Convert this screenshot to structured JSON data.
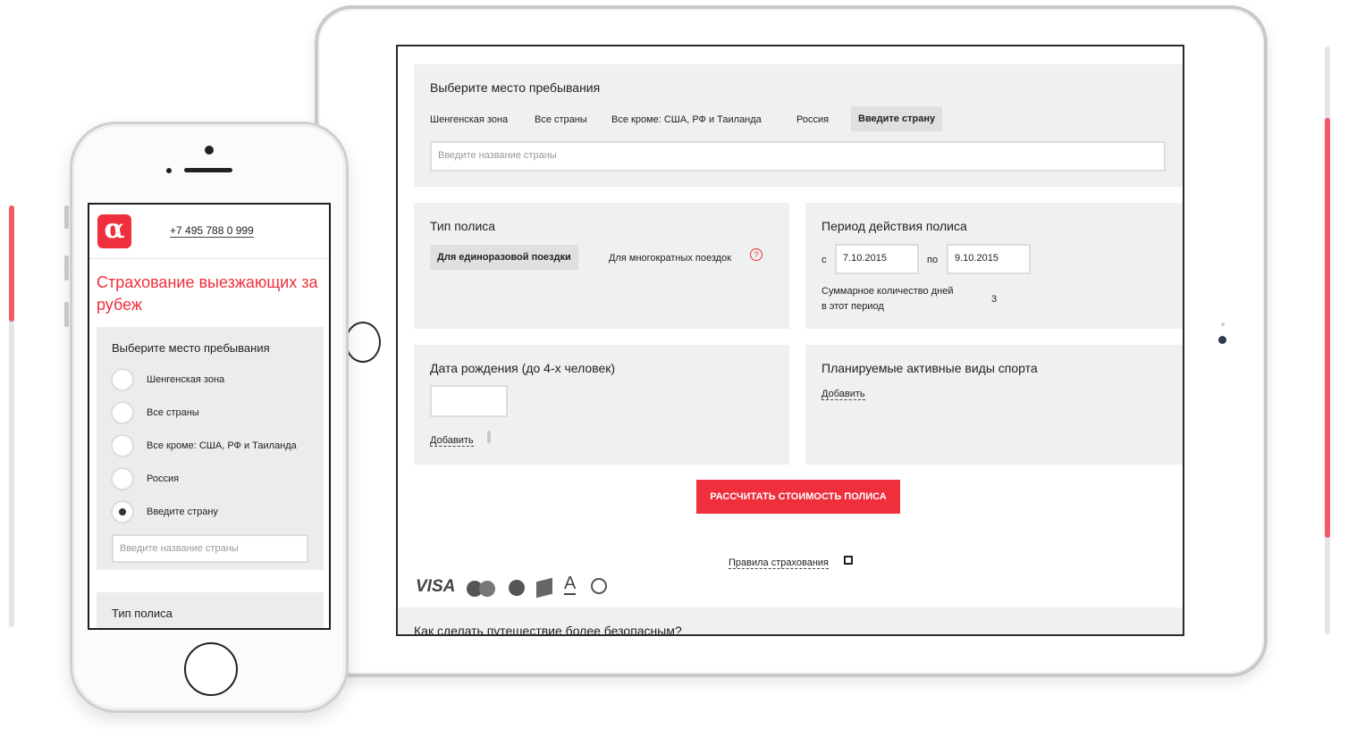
{
  "tablet": {
    "place_section": {
      "title": "Выберите место пребывания",
      "tabs": [
        "Шенгенская зона",
        "Все страны",
        "Все кроме: США, РФ и Таиланда",
        "Россия",
        "Введите страну"
      ],
      "active_tab": "Введите страну",
      "country_placeholder": "Введите название страны"
    },
    "policy_type": {
      "title": "Тип полиса",
      "option_single": "Для единоразовой поездки",
      "option_multi": "Для многократных поездок",
      "help_icon": "?"
    },
    "period": {
      "title": "Период действия полиса",
      "from_label": "с",
      "from_value": "7.10.2015",
      "to_label": "по",
      "to_value": "9.10.2015",
      "days_label_line1": "Суммарное количество дней",
      "days_label_line2": "в этот период",
      "days_value": "3"
    },
    "birth": {
      "title": "Дата рождения (до 4-х человек)",
      "add_link": "Добавить"
    },
    "sports": {
      "title": "Планируемые активные виды спорта",
      "add_link": "Добавить"
    },
    "calc_button": "РАССЧИТАТЬ СТОИМОСТЬ ПОЛИСА",
    "rules_link": "Правила страхования",
    "payment": {
      "visa": "VISA",
      "icons": [
        "mastercard-icon",
        "webmoney-icon",
        "book-icon",
        "a-icon",
        "q-icon"
      ]
    },
    "bottom_heading": "Как сделать путешествие более безопасным?"
  },
  "phone": {
    "phone_number": "+7 495 788 0 999",
    "logo": "α",
    "heading": "Страхование выезжающих за рубеж",
    "place_title": "Выберите место пребывания",
    "options": [
      "Шенгенская зона",
      "Все страны",
      "Все кроме: США, РФ и Таиланда",
      "Россия",
      "Введите страну"
    ],
    "selected_option": "Введите страну",
    "country_placeholder": "Введите название страны",
    "policy_title": "Тип полиса"
  },
  "colors": {
    "brand_red": "#ef2f3c",
    "panel_bg": "#eef1f0"
  }
}
